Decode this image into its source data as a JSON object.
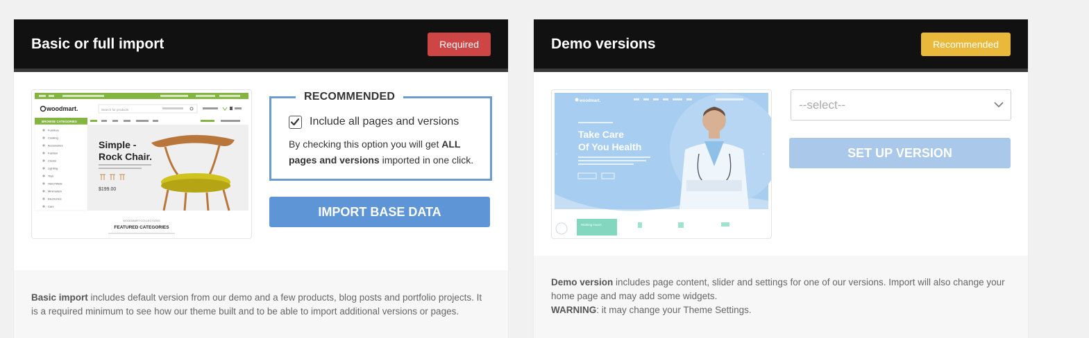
{
  "left": {
    "title": "Basic or full import",
    "badge": "Required",
    "preview": {
      "logo": "woodmart.",
      "search_placeholder": "Search for products",
      "browse_categories": "BROWSE CATEGORIES",
      "menu": [
        "Furniture",
        "Cooking",
        "Accessories",
        "Fashion",
        "Clocks",
        "Lighting",
        "Toys",
        "Hand Made",
        "Minimalism",
        "Electronics",
        "Cars"
      ],
      "hero_title_1": "Simple -",
      "hero_title_2": "Rock Chair.",
      "price": "$199.00",
      "section_small": "WOODMART COLLECTIONS",
      "section_title": "FEATURED CATEGORIES"
    },
    "recommended_label": "RECOMMENDED",
    "checkbox_label": "Include all pages and versions",
    "desc_part1": "By checking this option you will get ",
    "desc_bold": "ALL pages and versions",
    "desc_part2": " imported in one click.",
    "button": "IMPORT BASE DATA",
    "footer_bold": "Basic import",
    "footer_text": " includes default version from our demo and a few products, blog posts and portfolio projects. It is a required minimum to see how our theme built and to be able to import additional versions or pages."
  },
  "right": {
    "title": "Demo versions",
    "badge": "Recommended",
    "preview": {
      "logo": "woodmart.",
      "hero_line1": "Take Care",
      "hero_line2": "Of You Health",
      "card_label": "Working Hours"
    },
    "select_value": "--select--",
    "button": "SET UP VERSION",
    "footer_bold1": "Demo version",
    "footer_text1": " includes page content, slider and settings for one of our versions. Import will also change your home page and may add some widgets.",
    "footer_bold2": "WARNING",
    "footer_text2": ": it may change your Theme Settings."
  },
  "colors": {
    "required": "#cd4645",
    "recommended": "#eab83b",
    "primary_button": "#5d95d6",
    "disabled_button": "#a9c8ea",
    "header_bg": "#111111"
  },
  "icons": [
    "checkmark-icon",
    "chevron-down-icon"
  ]
}
